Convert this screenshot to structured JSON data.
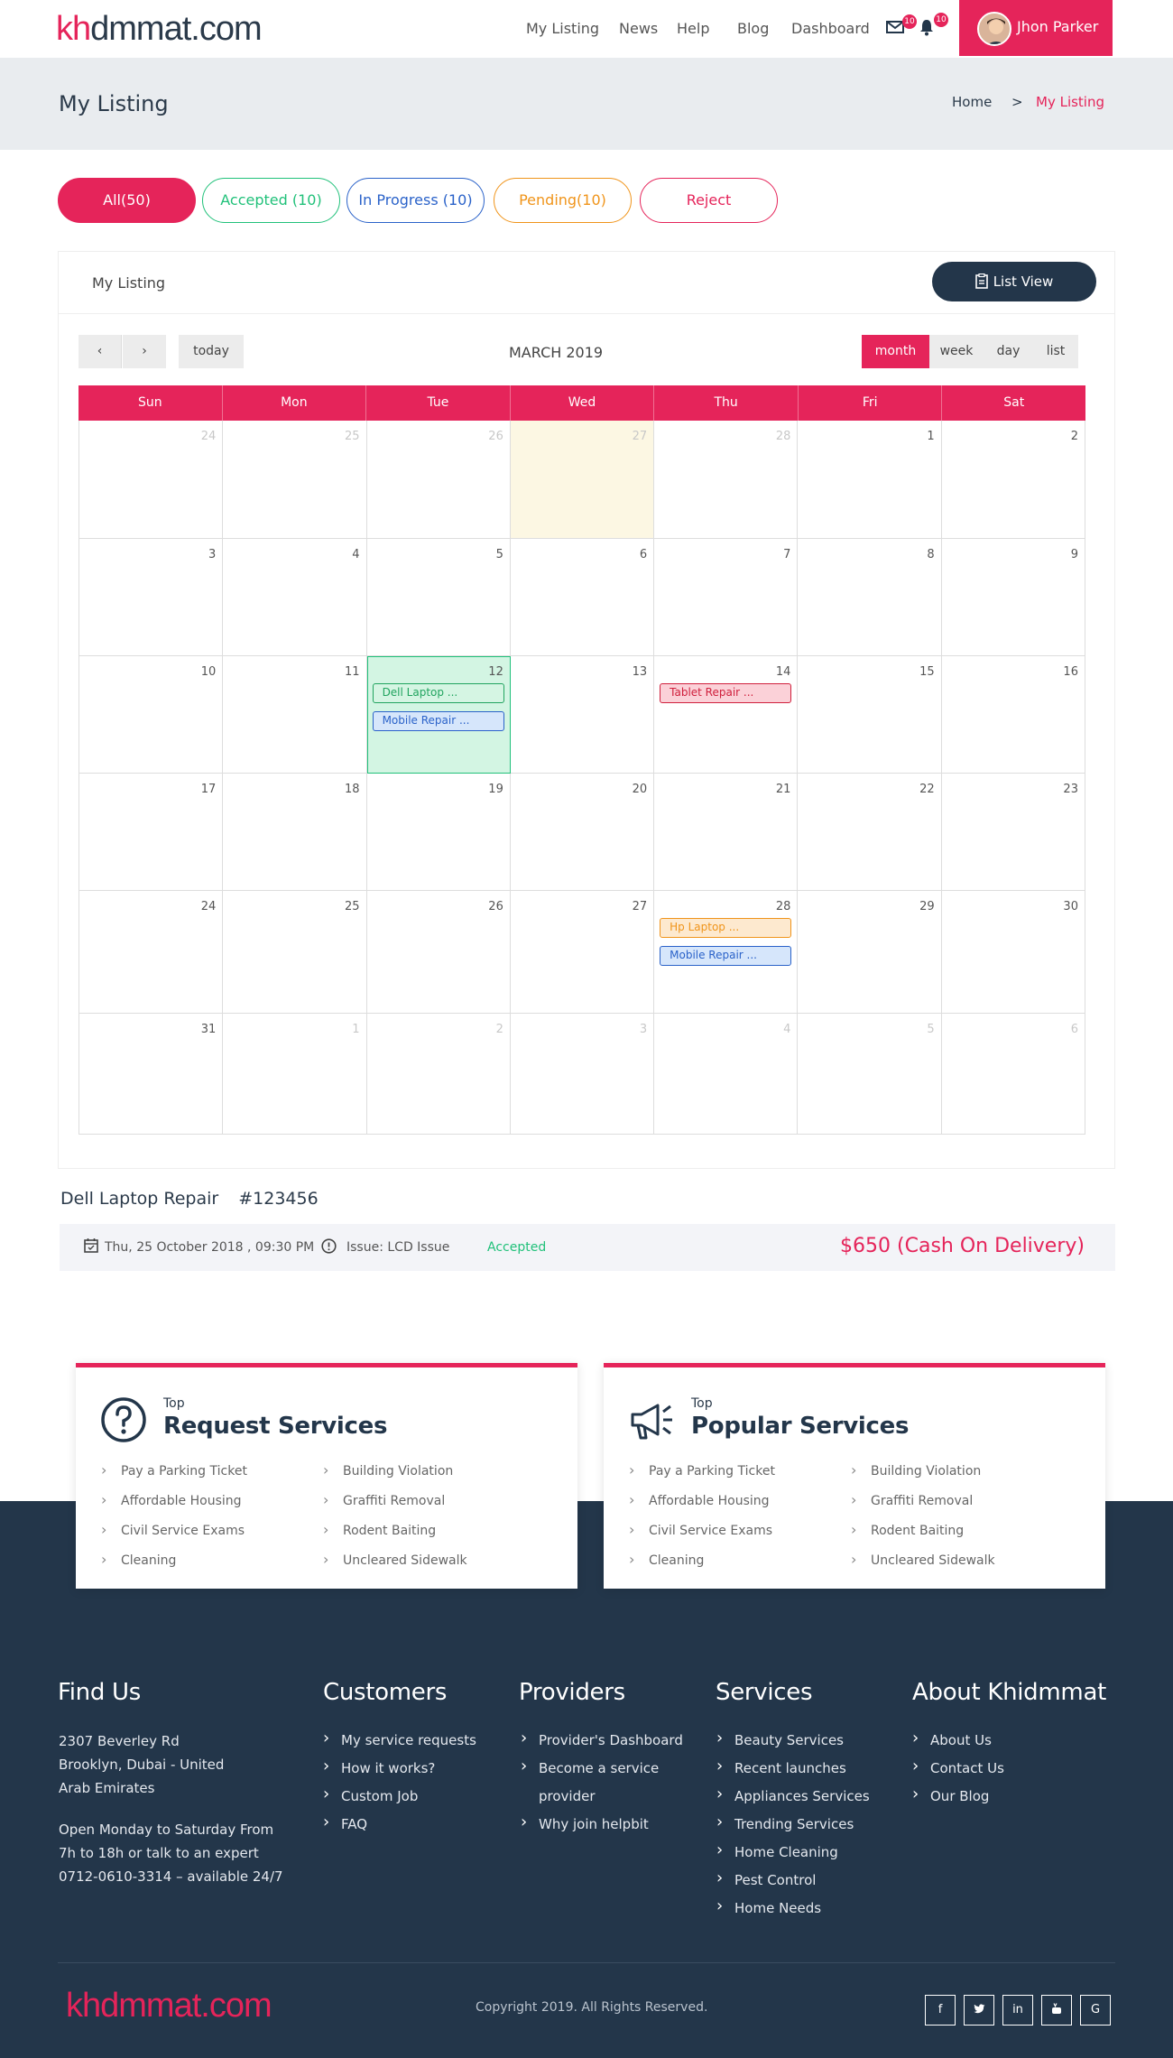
{
  "brand": {
    "logo_prefix": "kh",
    "logo_rest": "dmmat.com",
    "accent": "#e5245a",
    "dark": "#23364a"
  },
  "nav": {
    "items": [
      "My Listing",
      "News",
      "Help",
      "Blog",
      "Dashboard"
    ],
    "mail_badge": "10",
    "bell_badge": "10",
    "user_name": "Jhon Parker"
  },
  "page": {
    "title": "My Listing",
    "breadcrumb_home": "Home",
    "breadcrumb_sep": ">",
    "breadcrumb_current": "My Listing"
  },
  "filters": [
    {
      "label": "All(50)",
      "color": "#e5245a",
      "active": true
    },
    {
      "label": "Accepted (10)",
      "color": "#21c17a",
      "active": false
    },
    {
      "label": "In Progress (10)",
      "color": "#2a62c9",
      "active": false
    },
    {
      "label": "Pending(10)",
      "color": "#f0941a",
      "active": false
    },
    {
      "label": "Reject",
      "color": "#e5245a",
      "active": false
    }
  ],
  "listing": {
    "title": "My Listing",
    "list_view": "List  View"
  },
  "calendar": {
    "today": "today",
    "month_title": "MARCH 2019",
    "views": [
      "month",
      "week",
      "day",
      "list"
    ],
    "active_view": "month",
    "weekdays": [
      "Sun",
      "Mon",
      "Tue",
      "Wed",
      "Thu",
      "Fri",
      "Sat"
    ],
    "weeks": [
      [
        "24",
        "25",
        "26",
        "27",
        "28",
        "1",
        "2"
      ],
      [
        "3",
        "4",
        "5",
        "6",
        "7",
        "8",
        "9"
      ],
      [
        "10",
        "11",
        "12",
        "13",
        "14",
        "15",
        "16"
      ],
      [
        "17",
        "18",
        "19",
        "20",
        "21",
        "22",
        "23"
      ],
      [
        "24",
        "25",
        "26",
        "27",
        "28",
        "29",
        "30"
      ],
      [
        "31",
        "1",
        "2",
        "3",
        "4",
        "5",
        "6"
      ]
    ],
    "events": {
      "2-2": [
        {
          "label": "Dell Laptop ...",
          "kind": "green"
        },
        {
          "label": "Mobile Repair ...",
          "kind": "blue"
        }
      ],
      "2-4": [
        {
          "label": "Tablet Repair ...",
          "kind": "red"
        }
      ],
      "4-4": [
        {
          "label": "Hp Laptop ...",
          "kind": "orange"
        },
        {
          "label": "Mobile Repair ...",
          "kind": "blue"
        }
      ]
    }
  },
  "job": {
    "title": "Dell Laptop Repair",
    "id": "#123456",
    "date": "Thu, 25 October 2018 , 09:30 PM",
    "issue": "Issue:  LCD Issue",
    "status": "Accepted",
    "price": "$650 (Cash On Delivery)"
  },
  "services": [
    {
      "top": "Top",
      "title": "Request Services",
      "icon": "question-icon",
      "col1": [
        "Pay a Parking Ticket",
        "Affordable Housing",
        "Civil Service Exams",
        "Cleaning"
      ],
      "col2": [
        "Building Violation",
        "Graffiti Removal",
        "Rodent Baiting",
        "Uncleared Sidewalk"
      ]
    },
    {
      "top": "Top",
      "title": "Popular Services",
      "icon": "megaphone-icon",
      "col1": [
        "Pay a Parking Ticket",
        "Affordable Housing",
        "Civil Service Exams",
        "Cleaning"
      ],
      "col2": [
        "Building Violation",
        "Graffiti Removal",
        "Rodent Baiting",
        "Uncleared Sidewalk"
      ]
    }
  ],
  "footer": {
    "find_us": {
      "title": "Find Us",
      "address": [
        "2307 Beverley Rd",
        "Brooklyn, Dubai - United",
        "Arab Emirates"
      ],
      "hours": [
        "Open Monday to Saturday From",
        "7h to 18h or talk to an expert",
        "0712-0610-3314 – available 24/7"
      ]
    },
    "customers": {
      "title": "Customers",
      "items": [
        "My service requests",
        "How it works?",
        "Custom Job",
        "FAQ"
      ]
    },
    "providers": {
      "title": "Providers",
      "items": [
        "Provider's Dashboard",
        "Become a service",
        "provider",
        "Why join helpbit"
      ]
    },
    "services": {
      "title": "Services",
      "items": [
        "Beauty Services",
        "Recent launches",
        "Appliances Services",
        "Trending Services",
        "Home Cleaning",
        "Pest Control",
        "Home Needs"
      ]
    },
    "about": {
      "title": "About Khidmmat",
      "items": [
        "About Us",
        "Contact Us",
        "Our Blog"
      ]
    },
    "copyright": "Copyright 2019. All Rights Reserved.",
    "social": [
      "f",
      "t",
      "in",
      "yt",
      "G"
    ]
  }
}
